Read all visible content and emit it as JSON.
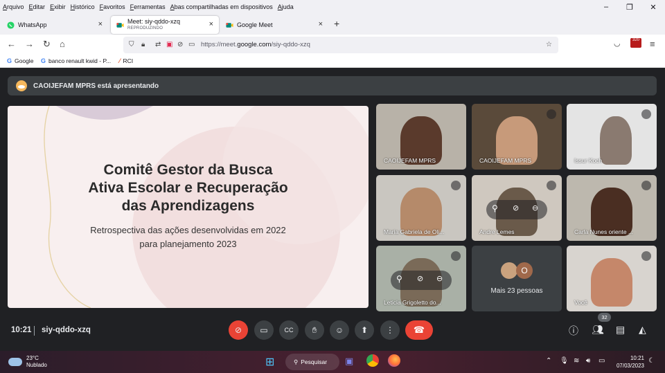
{
  "menu": [
    "Arquivo",
    "Editar",
    "Exibir",
    "Histórico",
    "Favoritos",
    "Ferramentas",
    "Abas compartilhadas em dispositivos",
    "Ajuda"
  ],
  "window_controls": {
    "minimize": "–",
    "restore": "❐",
    "close": "✕"
  },
  "tabs": [
    {
      "title": "WhatsApp",
      "subtitle": "",
      "active": false,
      "icon": "whatsapp-icon",
      "color": "#25d366"
    },
    {
      "title": "Meet: siy-qddo-xzq",
      "subtitle": "REPRODUZINDO",
      "active": true,
      "icon": "meet-icon",
      "color": "#00897b"
    },
    {
      "title": "Google Meet",
      "subtitle": "",
      "active": false,
      "icon": "meet-icon",
      "color": "#00897b"
    }
  ],
  "new_tab": "+",
  "tab_close": "×",
  "url": {
    "prefix": "https://meet.",
    "domain": "google.com",
    "path": "/siy-qddo-xzq"
  },
  "extension_badge": "320",
  "bookmarks": [
    {
      "label": "Google",
      "icon": "G"
    },
    {
      "label": "banco renault kwid - P...",
      "icon": "G"
    },
    {
      "label": "RCI",
      "icon": "⁄"
    }
  ],
  "presenting_text": "CAOIJEFAM MPRS está apresentando",
  "slide": {
    "title_lines": [
      "Comitê Gestor da Busca",
      "Ativa Escolar e Recuperação",
      "das Aprendizagens"
    ],
    "subtitle_lines": [
      "Retrospectiva das ações desenvolvidas em 2022",
      "para planejamento 2023"
    ]
  },
  "participants": [
    {
      "name": "CAOIJEFAM MPRS",
      "muted": false
    },
    {
      "name": "CAOIJEFAM MPRS",
      "muted": true
    },
    {
      "name": "Issur Koch",
      "muted": true
    },
    {
      "name": "Maria Gabriela de Oli...",
      "muted": true
    },
    {
      "name": "Andre Lemes",
      "muted": true
    },
    {
      "name": "Carla Nunes oriente ...",
      "muted": true
    },
    {
      "name": "Leticia Grigoletto do...",
      "muted": true
    },
    {
      "name": "Você",
      "muted": true
    }
  ],
  "more_people": {
    "label": "Mais 23 pessoas",
    "avatar_letter": "O"
  },
  "meeting": {
    "time": "10:21",
    "code": "siy-qddo-xzq",
    "participant_count": "32"
  },
  "taskbar": {
    "temperature": "23°C",
    "condition": "Nublado",
    "search_label": "Pesquisar",
    "time": "10:21",
    "date": "07/03/2023"
  }
}
